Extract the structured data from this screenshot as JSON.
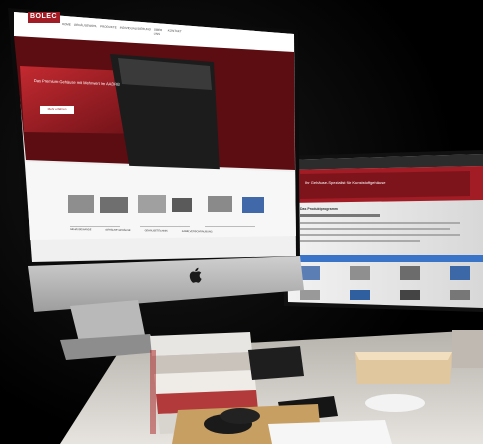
{
  "left_monitor": {
    "logo": "BOLEC",
    "nav_items": [
      "HOME",
      "GEHÄUSEWAHL",
      "PRODUKTE",
      "INDIVIDUALISIERUNG",
      "ÜBER UNS",
      "KONTAKT"
    ],
    "hero_title": "Das Premium-Gehäuse mit Mehrwert im AADRB",
    "hero_button": "Mehr erfahren",
    "category_labels": [
      "GEHÄUSEWANDE",
      "GEHÄUSE GEHÄUSE",
      "GEHÄUSETECHNIK",
      "KABELVERSCHRAUBUNG"
    ]
  },
  "right_monitor": {
    "banner_title": "Ihr Gehäuse-Spezialist für Kunststoffgehäuse",
    "section_title": "Das Produktprogramm"
  },
  "colors": {
    "brand_red": "#a11c24",
    "dark_red": "#5c0d12",
    "desk": "#dcd9d4"
  },
  "icons": [
    "apple-logo-icon"
  ]
}
